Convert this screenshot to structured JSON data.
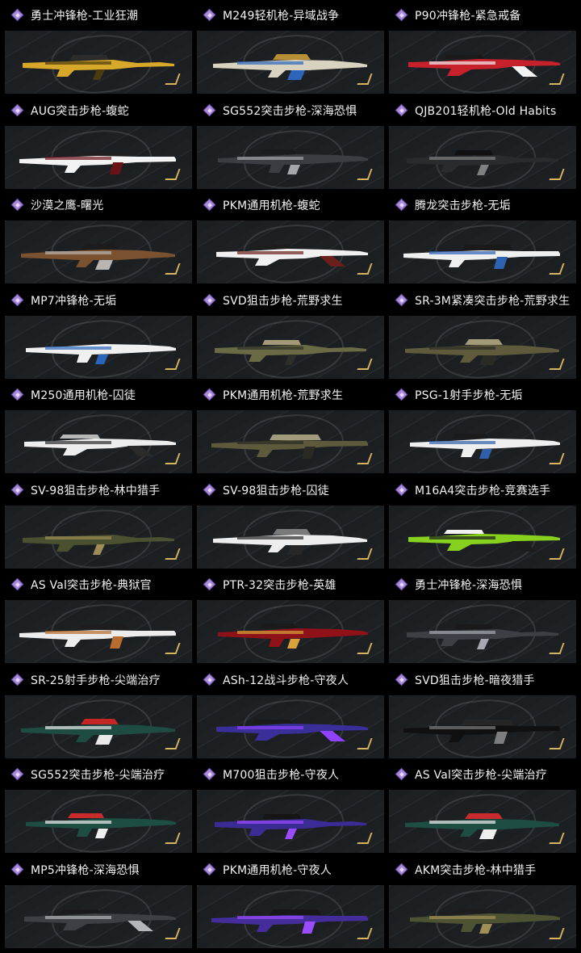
{
  "items": [
    {
      "title": "勇士冲锋枪-工业狂潮",
      "colors": [
        "#d8a82a",
        "#4d3b10",
        "#2c2c2c"
      ]
    },
    {
      "title": "M249轻机枪-异域战争",
      "colors": [
        "#d8d3c1",
        "#2c65ba",
        "#b88e34"
      ]
    },
    {
      "title": "P90冲锋枪-紧急戒备",
      "colors": [
        "#c7212c",
        "#f3f3f3",
        "#1a1a1a"
      ]
    },
    {
      "title": "AUG突击步枪-蝮蛇",
      "colors": [
        "#f3f3f3",
        "#6b1218",
        "#1f1f1f"
      ]
    },
    {
      "title": "SG552突击步枪-深海恐惧",
      "colors": [
        "#3a3d42",
        "#a3a6ab",
        "#1a1b1d"
      ]
    },
    {
      "title": "QJB201轻机枪-Old Habits",
      "colors": [
        "#2a2b2d",
        "#808080",
        "#111111"
      ]
    },
    {
      "title": "沙漠之鹰-曙光",
      "colors": [
        "#7a5230",
        "#b9b5b2",
        "#1c1c1c"
      ]
    },
    {
      "title": "PKM通用机枪-蝮蛇",
      "colors": [
        "#f0f0f0",
        "#6a1f1a",
        "#1d1d1d"
      ]
    },
    {
      "title": "腾龙突击步枪-无垢",
      "colors": [
        "#efefef",
        "#2e63b4",
        "#1a1a1a"
      ]
    },
    {
      "title": "MP7冲锋枪-无垢",
      "colors": [
        "#f0f0f0",
        "#2b65bb",
        "#1e1e1e"
      ]
    },
    {
      "title": "SVD狙击步枪-荒野求生",
      "colors": [
        "#6a6b45",
        "#2e2f2a",
        "#a49a79"
      ]
    },
    {
      "title": "SR-3M紧凑突击步枪-荒野求生",
      "colors": [
        "#5f5a3c",
        "#2b2b25",
        "#a39b78"
      ]
    },
    {
      "title": "M250通用机枪-囚徒",
      "colors": [
        "#ededed",
        "#2b2b2b",
        "#b7b7b7"
      ]
    },
    {
      "title": "PKM通用机枪-荒野求生",
      "colors": [
        "#5d5a3c",
        "#2a2a24",
        "#a19a7b"
      ]
    },
    {
      "title": "PSG-1射手步枪-无垢",
      "colors": [
        "#efefef",
        "#2f5fab",
        "#1b1b1b"
      ]
    },
    {
      "title": "SV-98狙击步枪-林中猎手",
      "colors": [
        "#4b5030",
        "#9e8d56",
        "#1f1f1f"
      ]
    },
    {
      "title": "SV-98狙击步枪-囚徒",
      "colors": [
        "#ededed",
        "#272727",
        "#7a7a7a"
      ]
    },
    {
      "title": "M16A4突击步枪-竞赛选手",
      "colors": [
        "#87d11e",
        "#1d1d1d",
        "#f1f1f1"
      ]
    },
    {
      "title": "AS Val突击步枪-典狱官",
      "colors": [
        "#ececec",
        "#b76d2e",
        "#1d1d1d"
      ]
    },
    {
      "title": "PTR-32突击步枪-英雄",
      "colors": [
        "#8e1218",
        "#d8a33a",
        "#1a1a1a"
      ]
    },
    {
      "title": "勇士冲锋枪-深海恐惧",
      "colors": [
        "#3c3f44",
        "#a5a9af",
        "#1a1a1a"
      ]
    },
    {
      "title": "SR-25射手步枪-尖端治疗",
      "colors": [
        "#1e4c43",
        "#e9e9e9",
        "#c42525"
      ]
    },
    {
      "title": "ASh-12战斗步枪-守夜人",
      "colors": [
        "#3a2f99",
        "#8f42ff",
        "#1a1a1a"
      ]
    },
    {
      "title": "SVD狙击步枪-暗夜猎手",
      "colors": [
        "#101010",
        "#7d7d7d",
        "#262626"
      ]
    },
    {
      "title": "SG552突击步枪-尖端治疗",
      "colors": [
        "#1d4d43",
        "#efefef",
        "#c72b2b"
      ]
    },
    {
      "title": "M700狙击步枪-守夜人",
      "colors": [
        "#3b2b95",
        "#9c4bff",
        "#151515"
      ]
    },
    {
      "title": "AS Val突击步枪-尖端治疗",
      "colors": [
        "#1d4d43",
        "#efefef",
        "#c72b2b"
      ]
    },
    {
      "title": "MP5冲锋枪-深海恐惧",
      "colors": [
        "#3c3f44",
        "#b2b5ba",
        "#1a1a1a"
      ]
    },
    {
      "title": "PKM通用机枪-守夜人",
      "colors": [
        "#442d9b",
        "#9a4cff",
        "#171717"
      ]
    },
    {
      "title": "AKM突击步枪-林中猎手",
      "colors": [
        "#4d5232",
        "#a18f57",
        "#1d1d1d"
      ]
    }
  ]
}
